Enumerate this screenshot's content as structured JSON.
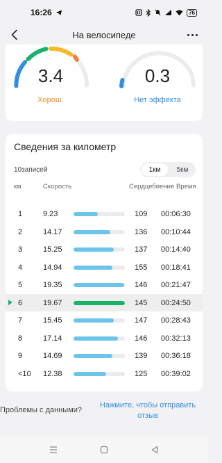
{
  "status_bar": {
    "time": "16:26",
    "battery": "76"
  },
  "header": {
    "title": "На велосипеде"
  },
  "gauges": [
    {
      "value": "3.4",
      "label": "Хорош."
    },
    {
      "value": "0.3",
      "label": "Нет эффекта"
    }
  ],
  "km_section": {
    "title": "Сведения за километр",
    "count": "10записей",
    "toggle": [
      "1км",
      "5км"
    ],
    "columns": {
      "km": "км",
      "speed": "Скорость",
      "hr": "Сердцебиение",
      "time": "Время"
    },
    "rows": [
      {
        "km": "1",
        "speed": "9.23",
        "fill": 0.47,
        "hr": "109",
        "time": "00:06:30",
        "selected": false
      },
      {
        "km": "2",
        "speed": "14.17",
        "fill": 0.72,
        "hr": "136",
        "time": "00:10:44",
        "selected": false
      },
      {
        "km": "3",
        "speed": "15.25",
        "fill": 0.78,
        "hr": "137",
        "time": "00:14:40",
        "selected": false
      },
      {
        "km": "4",
        "speed": "14.94",
        "fill": 0.76,
        "hr": "155",
        "time": "00:18:41",
        "selected": false
      },
      {
        "km": "5",
        "speed": "19.35",
        "fill": 0.98,
        "hr": "146",
        "time": "00:21:47",
        "selected": false
      },
      {
        "km": "6",
        "speed": "19.67",
        "fill": 1.0,
        "hr": "145",
        "time": "00:24:50",
        "selected": true
      },
      {
        "km": "7",
        "speed": "15.45",
        "fill": 0.78,
        "hr": "147",
        "time": "00:28:43",
        "selected": false
      },
      {
        "km": "8",
        "speed": "17.14",
        "fill": 0.87,
        "hr": "146",
        "time": "00:32:13",
        "selected": false
      },
      {
        "km": "9",
        "speed": "14.69",
        "fill": 0.75,
        "hr": "139",
        "time": "00:36:18",
        "selected": false
      },
      {
        "km": "<10",
        "speed": "12.38",
        "fill": 0.63,
        "hr": "125",
        "time": "00:39:02",
        "selected": false
      }
    ]
  },
  "footer": {
    "question": "Проблемы с данными?",
    "link": "Нажмите, чтобы отправить отзыв"
  },
  "colors": {
    "bar": "#6cc4ea",
    "bar_selected": "#19b36b",
    "accent_blue": "#2f8fe0",
    "good_orange": "#ef8b2c"
  },
  "icons": [
    "back-arrow-icon",
    "more-dots-icon",
    "menu-nav-icon",
    "home-nav-icon",
    "back-nav-icon",
    "telegram-icon",
    "nfc-icon",
    "bluetooth-icon",
    "mute-icon",
    "signal-icon",
    "wifi-icon"
  ]
}
